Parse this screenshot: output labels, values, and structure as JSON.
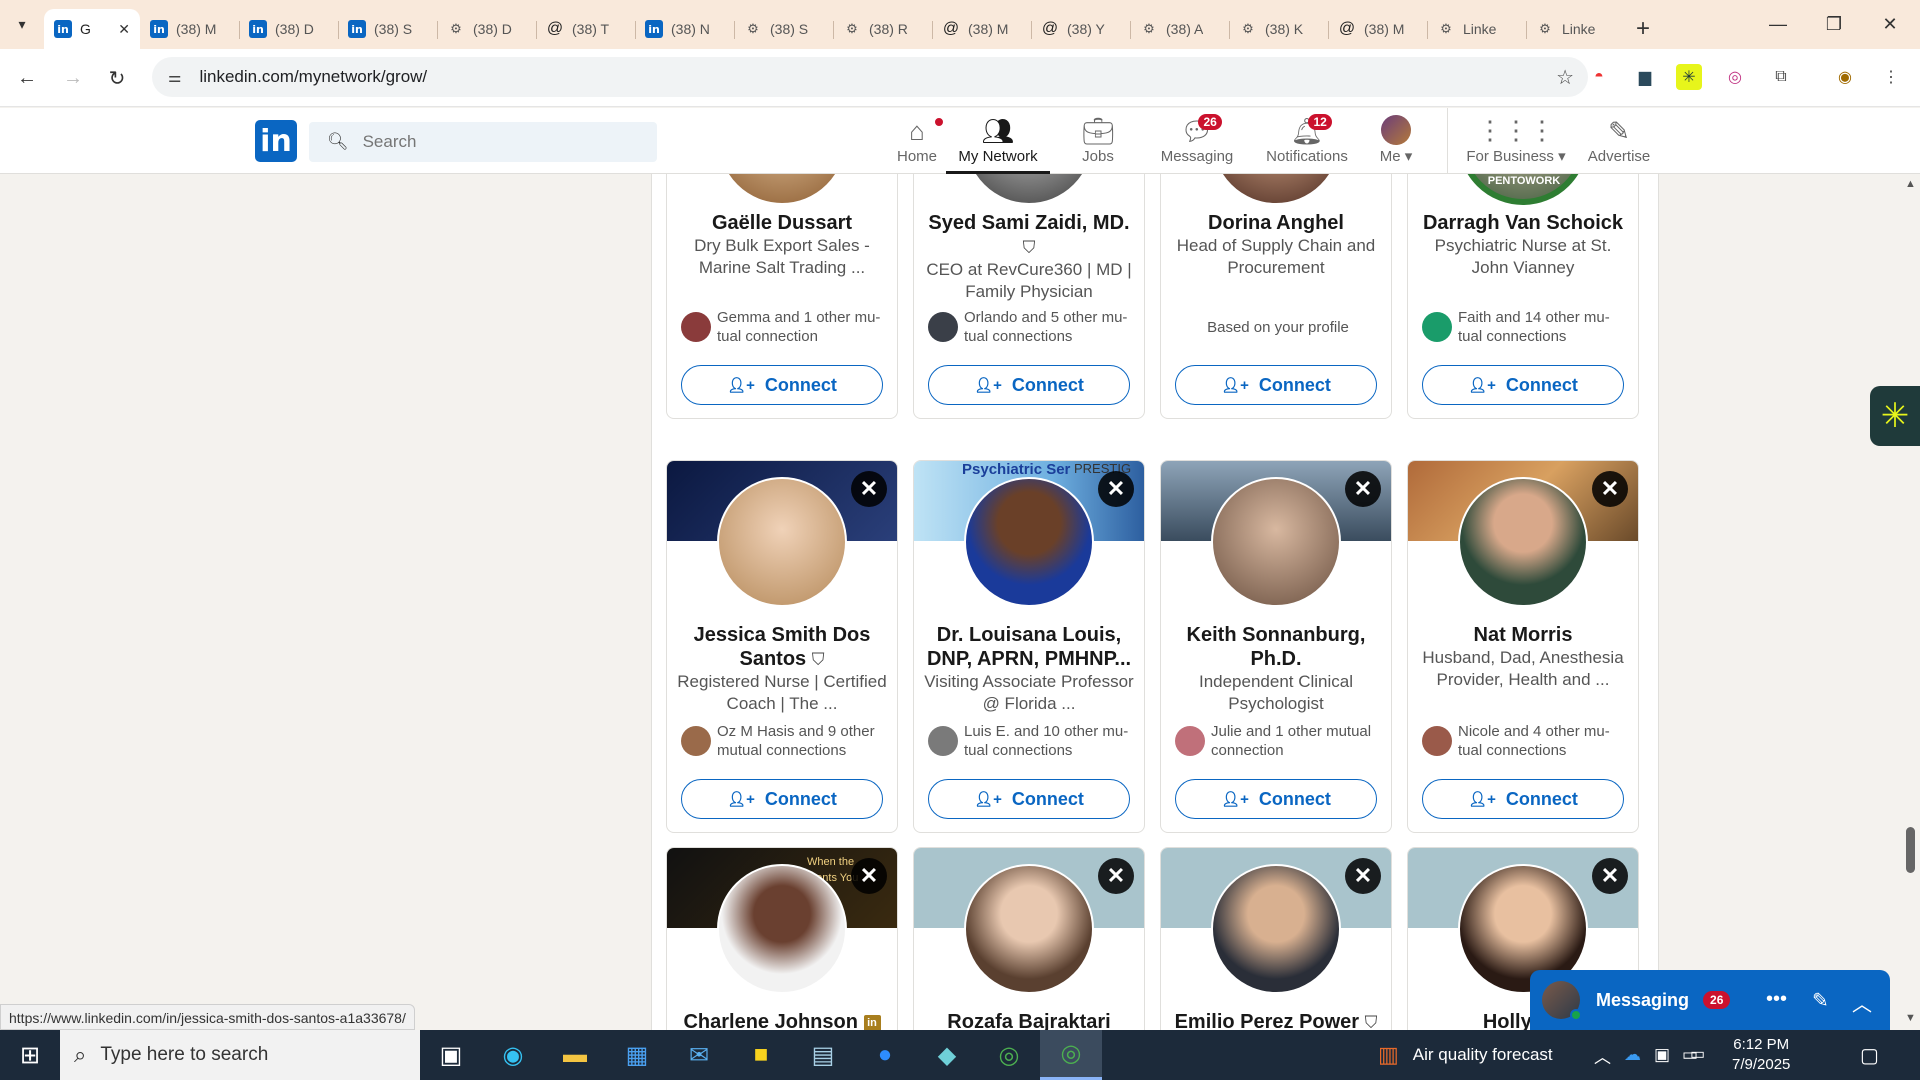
{
  "browser": {
    "tabs": [
      {
        "label": "G",
        "icon": "li",
        "active": true
      },
      {
        "label": "(38) M",
        "icon": "li"
      },
      {
        "label": "(38) D",
        "icon": "li"
      },
      {
        "label": "(38) S",
        "icon": "li"
      },
      {
        "label": "(38) D",
        "icon": "gear"
      },
      {
        "label": "(38) T",
        "icon": "threads"
      },
      {
        "label": "(38) N",
        "icon": "li"
      },
      {
        "label": "(38) S",
        "icon": "gear"
      },
      {
        "label": "(38) R",
        "icon": "gear"
      },
      {
        "label": "(38) M",
        "icon": "threads"
      },
      {
        "label": "(38) Y",
        "icon": "threads"
      },
      {
        "label": "(38) A",
        "icon": "gear"
      },
      {
        "label": "(38) K",
        "icon": "gear"
      },
      {
        "label": "(38) M",
        "icon": "threads"
      },
      {
        "label": "Linke",
        "icon": "gear"
      },
      {
        "label": "Linke",
        "icon": "gear"
      }
    ],
    "url": "linkedin.com/mynetwork/grow/",
    "status_url": "https://www.linkedin.com/in/jessica-smith-dos-santos-a1a33678/"
  },
  "linkedin": {
    "search_placeholder": "Search",
    "nav": {
      "home": "Home",
      "network": "My Network",
      "jobs": "Jobs",
      "messaging": "Messaging",
      "messaging_badge": "26",
      "notifications": "Notifications",
      "notifications_badge": "12",
      "me": "Me",
      "business": "For Business",
      "advertise": "Advertise"
    },
    "connect_label": "Connect",
    "row1": [
      {
        "name": "Gaëlle Dussart",
        "headline": "Dry Bulk Export Sales - Marine Salt Trading ...",
        "mutual": "Gemma and 1 other mu-tual connection"
      },
      {
        "name": "Syed Sami Zaidi, MD.",
        "headline": "CEO at RevCure360 |  MD | Family Physician",
        "mutual": "Orlando and 5 other mu-tual connections"
      },
      {
        "name": "Dorina Anghel",
        "headline": "Head of Supply Chain and Procurement",
        "mutual": "Based on your profile"
      },
      {
        "name": "Darragh Van Schoick",
        "headline": "Psychiatric Nurse at St. John Vianney",
        "mutual": "Faith and 14 other mu-tual connections"
      }
    ],
    "row2": [
      {
        "name": "Jessica Smith Dos Santos",
        "headline": "Registered Nurse | Certified Coach | The ...",
        "mutual": "Oz M Hasis and 9 other mutual connections"
      },
      {
        "name": "Dr. Louisana Louis, DNP, APRN, PMHNP...",
        "headline": "Visiting Associate Professor @ Florida ...",
        "mutual": "Luis E. and 10 other mu-tual connections"
      },
      {
        "name": "Keith Sonnanburg, Ph.D.",
        "headline": "Independent Clinical Psychologist",
        "mutual": "Julie and 1 other mutual connection"
      },
      {
        "name": "Nat Morris",
        "headline": "Husband, Dad, Anesthesia Provider, Health and ...",
        "mutual": "Nicole and 4 other mu-tual connections"
      }
    ],
    "row3": [
      {
        "name": "Charlene Johnson"
      },
      {
        "name": "Rozafa Bajraktari"
      },
      {
        "name": "Emilio Perez Power"
      },
      {
        "name": "Holly An"
      }
    ],
    "banner_texts": {
      "psychiatric": "Psychiatric Ser",
      "prestig": "PRESTIG",
      "pentowork": "PENTOWORK",
      "when_the": "When the",
      "yourself": "ments You"
    },
    "messaging": {
      "title": "Messaging",
      "count": "26"
    }
  },
  "taskbar": {
    "search_placeholder": "Type here to search",
    "weather": "Air quality forecast",
    "time": "6:12 PM",
    "date": "7/9/2025"
  },
  "colors": {
    "linkedin_blue": "#0a66c2",
    "badge_red": "#cb112d",
    "tab_strip": "#f9e9db"
  }
}
